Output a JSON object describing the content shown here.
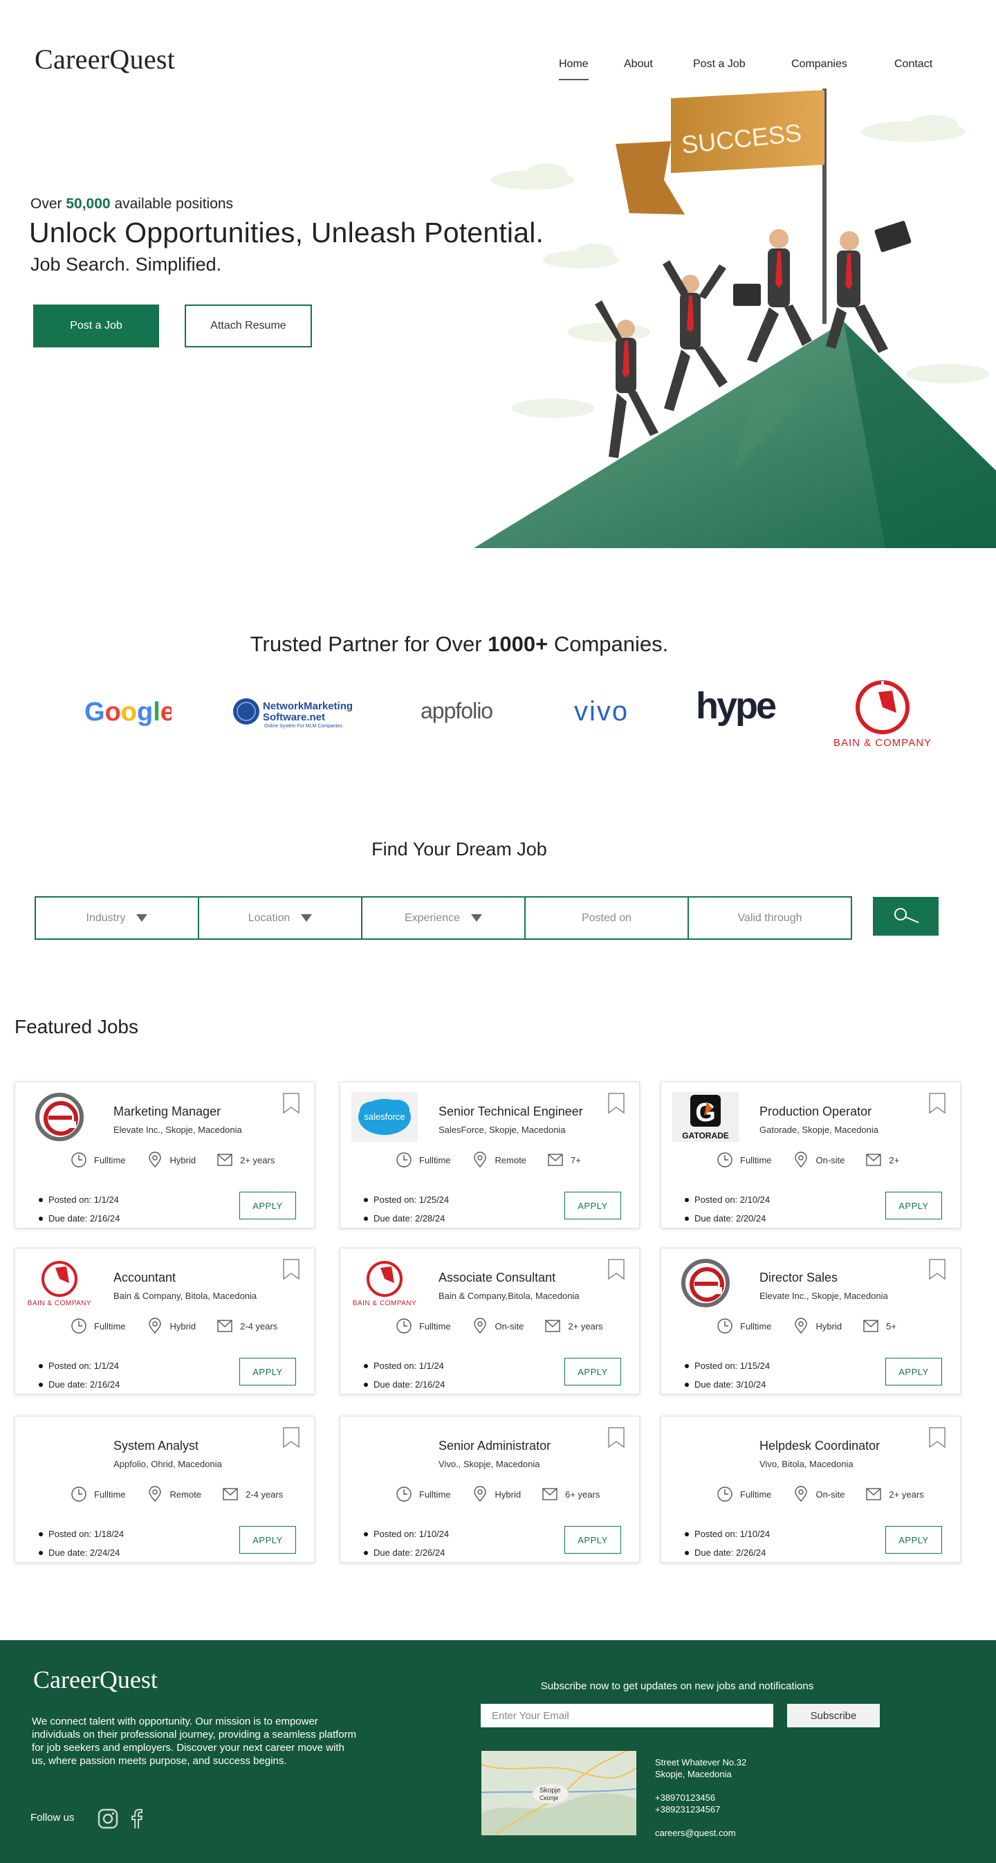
{
  "brand": {
    "name": "CareerQuest",
    "accent": "#15744f",
    "footer_bg": "#15573c"
  },
  "nav": {
    "items": [
      {
        "label": "Home",
        "active": true
      },
      {
        "label": "About",
        "active": false
      },
      {
        "label": "Post a Job",
        "active": false
      },
      {
        "label": "Companies",
        "active": false
      },
      {
        "label": "Contact",
        "active": false
      }
    ]
  },
  "hero": {
    "over_prefix": "Over",
    "over_count": "50,000",
    "over_suffix": "available positions",
    "title": "Unlock Opportunities, Unleash Potential.",
    "subtitle": "Job Search. Simplified.",
    "primary_button": "Post a Job",
    "secondary_button": "Attach Resume",
    "flag_text": "SUCCESS"
  },
  "trusted": {
    "prefix": "Trusted Partner for Over",
    "count": "1000+",
    "suffix": "Companies.",
    "logos": [
      "Google",
      "NetworkMarketing Software.net",
      "appfolio",
      "vivo",
      "hype",
      "BAIN & COMPANY"
    ],
    "nm_line1": "NetworkMarketing",
    "nm_line2": "Software.net",
    "nm_tag": "Online System For MLM Companies"
  },
  "search": {
    "title": "Find Your Dream Job",
    "filters": [
      {
        "label": "Industry",
        "dropdown": true
      },
      {
        "label": "Location",
        "dropdown": true
      },
      {
        "label": "Experience",
        "dropdown": true
      },
      {
        "label": "Posted on",
        "dropdown": false
      },
      {
        "label": "Valid through",
        "dropdown": false
      }
    ],
    "button_icon": "search-icon"
  },
  "featured": {
    "title": "Featured Jobs",
    "apply_label": "APPLY",
    "jobs": [
      {
        "title": "Marketing Manager",
        "company": "Elevate Inc., Skopje, Macedonia",
        "type": "Fulltime",
        "mode": "Hybrid",
        "exp": "2+ years",
        "posted": "Posted on: 1/1/24",
        "due": "Due date: 2/16/24",
        "logo": "elevate"
      },
      {
        "title": "Senior Technical Engineer",
        "company": "SalesForce, Skopje, Macedonia",
        "type": "Fulltime",
        "mode": "Remote",
        "exp": "7+",
        "posted": "Posted on: 1/25/24",
        "due": "Due date: 2/28/24",
        "logo": "salesforce"
      },
      {
        "title": "Production Operator",
        "company": "Gatorade, Skopje, Macedonia",
        "type": "Fulltime",
        "mode": "On-site",
        "exp": "2+",
        "posted": "Posted on: 2/10/24",
        "due": "Due date: 2/20/24",
        "logo": "gatorade"
      },
      {
        "title": "Accountant",
        "company": "Bain & Company, Bitola, Macedonia",
        "type": "Fulltime",
        "mode": "Hybrid",
        "exp": "2-4 years",
        "posted": "Posted on: 1/1/24",
        "due": "Due date: 2/16/24",
        "logo": "bain"
      },
      {
        "title": "Associate Consultant",
        "company": "Bain & Company,Bitola, Macedonia",
        "type": "Fulltime",
        "mode": "On-site",
        "exp": "2+ years",
        "posted": "Posted on: 1/1/24",
        "due": "Due date: 2/16/24",
        "logo": "bain"
      },
      {
        "title": "Director Sales",
        "company": "Elevate Inc., Skopje, Macedonia",
        "type": "Fulltime",
        "mode": "Hybrid",
        "exp": "5+",
        "posted": "Posted on: 1/15/24",
        "due": "Due date: 3/10/24",
        "logo": "elevate"
      },
      {
        "title": "System Analyst",
        "company": "Appfolio, Ohrid, Macedonia",
        "type": "Fulltime",
        "mode": "Remote",
        "exp": "2-4 years",
        "posted": "Posted on: 1/18/24",
        "due": "Due date: 2/24/24",
        "logo": "none"
      },
      {
        "title": "Senior Administrator",
        "company": "Vivo., Skopje, Macedonia",
        "type": "Fulltime",
        "mode": "Hybrid",
        "exp": "6+ years",
        "posted": "Posted on: 1/10/24",
        "due": "Due date: 2/26/24",
        "logo": "none"
      },
      {
        "title": "Helpdesk Coordinator",
        "company": "Vivo, Bitola, Macedonia",
        "type": "Fulltime",
        "mode": "On-site",
        "exp": "2+ years",
        "posted": "Posted on: 1/10/24",
        "due": "Due date: 2/26/24",
        "logo": "none"
      }
    ]
  },
  "footer": {
    "logo": "CareerQuest",
    "mission": "We connect talent with opportunity. Our mission is to empower individuals on their professional journey, providing a seamless platform for job seekers and employers. Discover your next career move with us, where passion meets purpose, and success begins.",
    "follow": "Follow us",
    "subscribe_text": "Subscribe now to get updates on new jobs and notifications",
    "email_placeholder": "Enter Your Email",
    "subscribe_button": "Subscribe",
    "map_label": "Skopje",
    "map_label_local": "Скопје",
    "address1": "Street Whatever No.32",
    "address2": "Skopje, Macedonia",
    "phone1": "+38970123456",
    "phone2": "+389231234567",
    "email": "careers@quest.com"
  }
}
